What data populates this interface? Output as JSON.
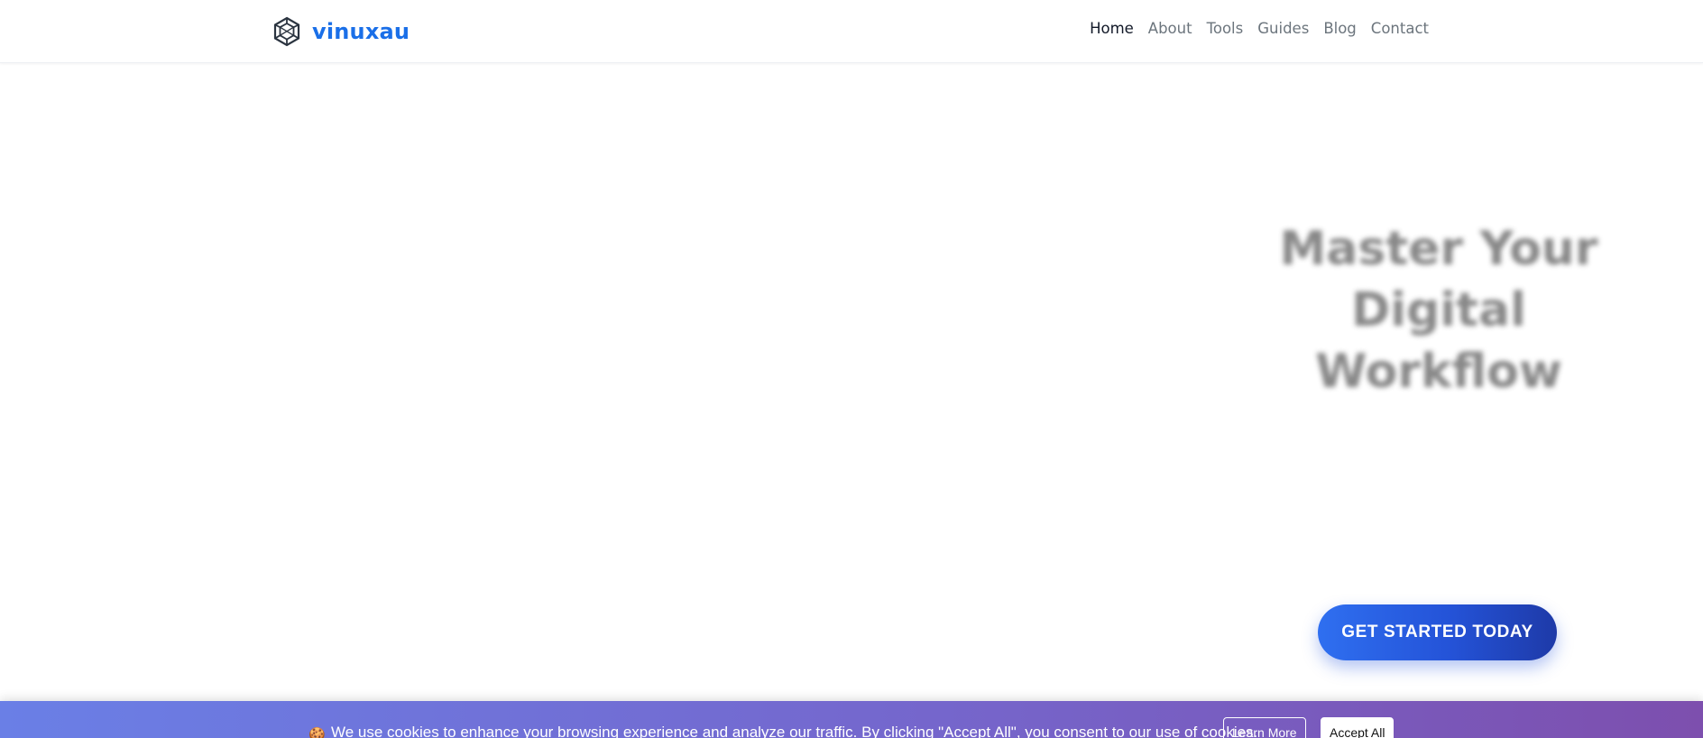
{
  "header": {
    "brand": {
      "name": "vinuxau",
      "logo_icon": "cube-wireframe-icon"
    },
    "nav": [
      {
        "label": "Home",
        "active": true
      },
      {
        "label": "About",
        "active": false
      },
      {
        "label": "Tools",
        "active": false
      },
      {
        "label": "Guides",
        "active": false
      },
      {
        "label": "Blog",
        "active": false
      },
      {
        "label": "Contact",
        "active": false
      }
    ]
  },
  "hero": {
    "title_lines": [
      "Master Your",
      "Digital",
      "Workflow"
    ],
    "cta_label": "GET STARTED TODAY"
  },
  "cookie_banner": {
    "icon": "cookie-icon",
    "text": "We use cookies to enhance your browsing experience and analyze our traffic. By clicking \"Accept All\", you consent to our use of cookies.",
    "learn_more_label": "Learn More",
    "accept_label": "Accept All"
  },
  "colors": {
    "brand_blue": "#1a6fe8",
    "cta_gradient": [
      "#2f6ff0",
      "#1e3aa8"
    ],
    "cookie_gradient": [
      "#6a7fe6",
      "#7d4fae"
    ]
  }
}
